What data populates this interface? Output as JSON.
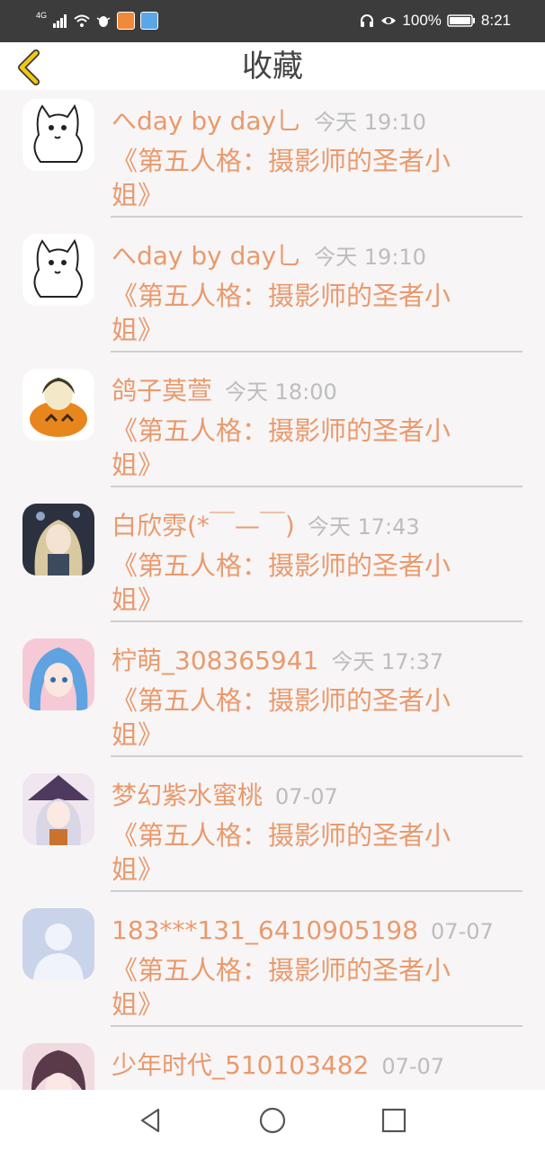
{
  "status_bar": {
    "battery": "100%",
    "time": "8:21",
    "signal_label": "4G"
  },
  "header": {
    "title": "收藏"
  },
  "items": [
    {
      "user": "へday by day乚",
      "time": "今天 19:10",
      "title": "《第五人格：摄影师的圣者小姐》",
      "avatar": "cat-sketch-avatar"
    },
    {
      "user": "へday by day乚",
      "time": "今天 19:10",
      "title": "《第五人格：摄影师的圣者小姐》",
      "avatar": "cat-sketch-avatar"
    },
    {
      "user": "鸽子莫萱",
      "time": "今天 18:00",
      "title": "《第五人格：摄影师的圣者小姐》",
      "avatar": "pumpkin-avatar"
    },
    {
      "user": "白欣雰(*￣—￣)",
      "time": "今天 17:43",
      "title": "《第五人格：摄影师的圣者小姐》",
      "avatar": "anime-girl-avatar"
    },
    {
      "user": "柠萌_308365941",
      "time": "今天 17:37",
      "title": "《第五人格：摄影师的圣者小姐》",
      "avatar": "blue-hair-avatar"
    },
    {
      "user": "梦幻紫水蜜桃",
      "time": "07-07",
      "title": "《第五人格：摄影师的圣者小姐》",
      "avatar": "witch-avatar"
    },
    {
      "user": "183***131_6410905198",
      "time": "07-07",
      "title": "《第五人格：摄影师的圣者小姐》",
      "avatar": "default-user-avatar"
    },
    {
      "user": "少年时代_510103482",
      "time": "07-07",
      "title": "",
      "avatar": "anime-boy-avatar"
    }
  ],
  "colors": {
    "accent": "#e99a6d",
    "back_arrow": "#f2c811",
    "status_bar_bg": "#3c3c3c"
  }
}
